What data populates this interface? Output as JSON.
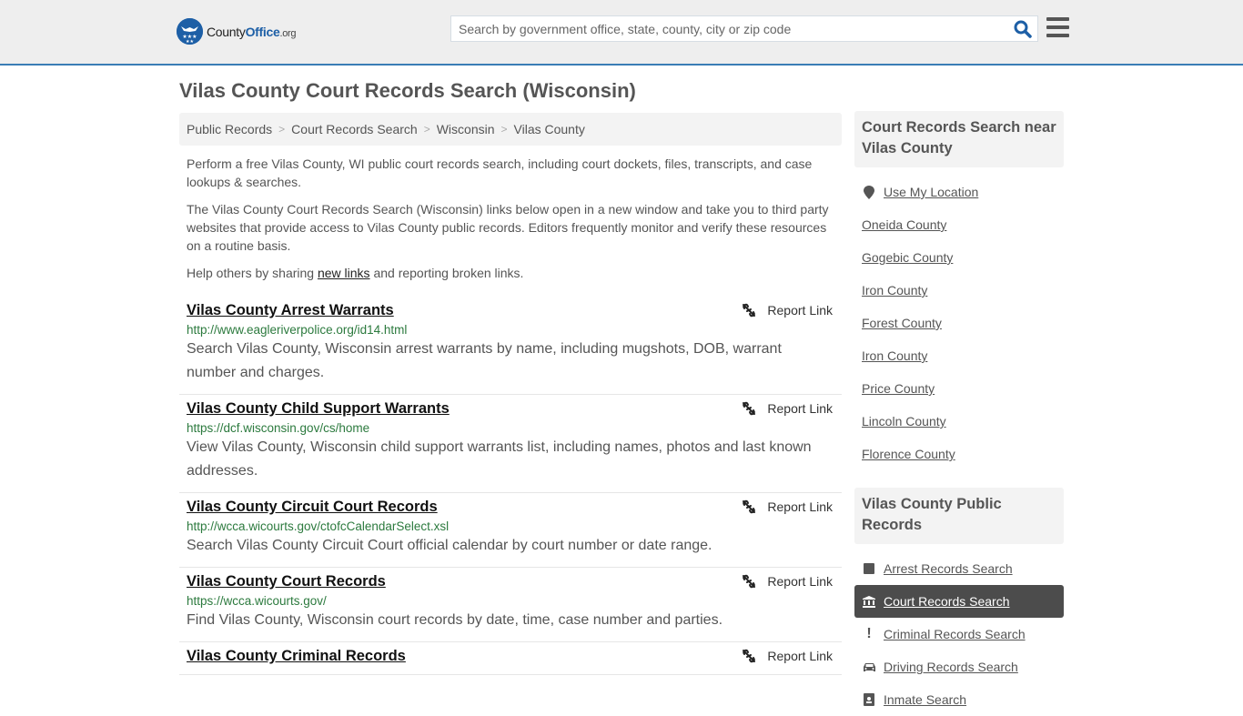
{
  "header": {
    "logo": {
      "name_part1": "County",
      "name_part2": "Office",
      "tld": ".org"
    },
    "search_placeholder": "Search by government office, state, county, city or zip code",
    "search_value": "",
    "colors": {
      "accent": "#3a7db5",
      "brand": "#1d5fa6",
      "header_bg": "#eeeeee"
    }
  },
  "page_title": "Vilas County Court Records Search (Wisconsin)",
  "breadcrumb": [
    "Public Records",
    "Court Records Search",
    "Wisconsin",
    "Vilas County"
  ],
  "intro": {
    "p1": "Perform a free Vilas County, WI public court records search, including court dockets, files, transcripts, and case lookups & searches.",
    "p2": "The Vilas County Court Records Search (Wisconsin) links below open in a new window and take you to third party websites that provide access to Vilas County public records. Editors frequently monitor and verify these resources on a routine basis.",
    "p3_before": "Help others by sharing ",
    "p3_link": "new links",
    "p3_after": " and reporting broken links."
  },
  "report_label": "Report Link",
  "results": [
    {
      "title": "Vilas County Arrest Warrants",
      "url": "http://www.eagleriverpolice.org/id14.html",
      "desc": "Search Vilas County, Wisconsin arrest warrants by name, including mugshots, DOB, warrant number and charges."
    },
    {
      "title": "Vilas County Child Support Warrants",
      "url": "https://dcf.wisconsin.gov/cs/home",
      "desc": "View Vilas County, Wisconsin child support warrants list, including names, photos and last known addresses."
    },
    {
      "title": "Vilas County Circuit Court Records",
      "url": "http://wcca.wicourts.gov/ctofcCalendarSelect.xsl",
      "desc": "Search Vilas County Circuit Court official calendar by court number or date range."
    },
    {
      "title": "Vilas County Court Records",
      "url": "https://wcca.wicourts.gov/",
      "desc": "Find Vilas County, Wisconsin court records by date, time, case number and parties."
    },
    {
      "title": "Vilas County Criminal Records",
      "url": "",
      "desc": ""
    }
  ],
  "sidebar": {
    "nearby": {
      "heading": "Court Records Search near Vilas County",
      "use_location": "Use My Location",
      "items": [
        "Oneida County",
        "Gogebic County",
        "Iron County",
        "Forest County",
        "Iron County",
        "Price County",
        "Lincoln County",
        "Florence County"
      ]
    },
    "public_records": {
      "heading": "Vilas County Public Records",
      "items": [
        {
          "label": "Arrest Records Search",
          "icon": "square-icon",
          "active": false
        },
        {
          "label": "Court Records Search",
          "icon": "courthouse-icon",
          "active": true
        },
        {
          "label": "Criminal Records Search",
          "icon": "exclamation-icon",
          "active": false
        },
        {
          "label": "Driving Records Search",
          "icon": "car-icon",
          "active": false
        },
        {
          "label": "Inmate Search",
          "icon": "id-badge-icon",
          "active": false
        }
      ]
    }
  }
}
